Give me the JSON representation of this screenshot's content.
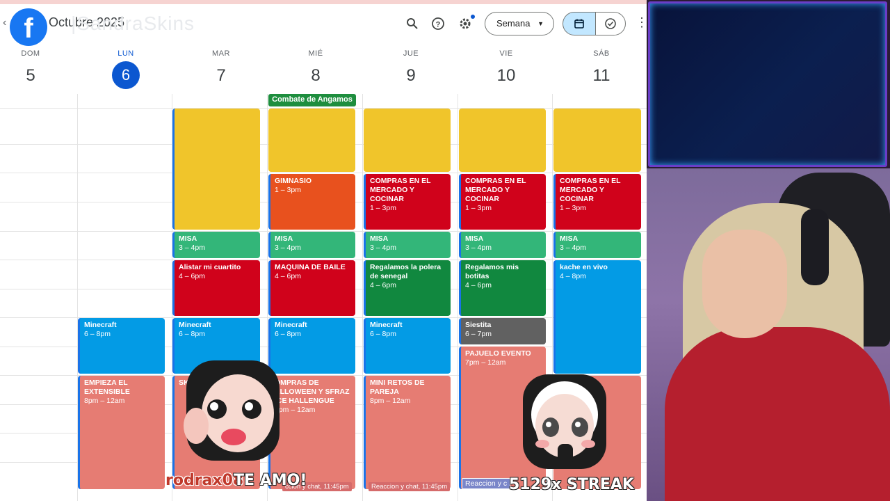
{
  "header": {
    "month": "Octubre 2025",
    "watermark": "|SandraSkins",
    "view_label": "Semana",
    "facebook_glyph": "f"
  },
  "days": [
    {
      "name": "DOM",
      "num": "5"
    },
    {
      "name": "LUN",
      "num": "6"
    },
    {
      "name": "MAR",
      "num": "7"
    },
    {
      "name": "MIÉ",
      "num": "8"
    },
    {
      "name": "JUE",
      "num": "9"
    },
    {
      "name": "VIE",
      "num": "10"
    },
    {
      "name": "SÁB",
      "num": "11"
    }
  ],
  "allday": {
    "title": "Combate de Angamos"
  },
  "events": {
    "gimnasio": {
      "title": "GIMNASIO",
      "time": "1 – 3pm"
    },
    "compras": {
      "title": "COMPRAS EN EL MERCADO Y COCINAR",
      "time": "1 – 3pm"
    },
    "misa": {
      "title": "MISA",
      "time": "3 – 4pm"
    },
    "alistar": {
      "title": "Alistar mi cuartito",
      "time": "4 – 6pm"
    },
    "maquina": {
      "title": "MAQUINA DE BAILE",
      "time": "4 – 6pm"
    },
    "polera": {
      "title": "Regalamos la polera de senegal",
      "time": "4 – 6pm"
    },
    "botitas": {
      "title": "Regalamos mis botitas",
      "time": "4 – 6pm"
    },
    "kache": {
      "title": "kache en vivo",
      "time": "4 – 8pm"
    },
    "minecraft": {
      "title": "Minecraft",
      "time": "6 – 8pm"
    },
    "siestita": {
      "title": "Siestita",
      "time": "6 – 7pm"
    },
    "pajuelo": {
      "title": "PAJUELO EVENTO",
      "time": "7pm – 12am"
    },
    "empieza": {
      "title": "EMPIEZA EL EXTENSIBLE",
      "time": "8pm – 12am"
    },
    "skinca": {
      "title": "SKINCA"
    },
    "halloween": {
      "title": "OMPRAS DE ALLOWEEN Y SFRAZ ICE HALLENGUE",
      "time": "8pm – 12am"
    },
    "retos": {
      "title": "MINI RETOS DE PAREJA",
      "time": "8pm – 12am"
    },
    "reaccion_chat": "Reaccion y chat, 11:45pm",
    "reaccion_chat_cut": "ccion y chat, 11:45pm",
    "reaccion_short": "Reaccion y c"
  },
  "overlays": {
    "username": "rodrax08",
    "message": "TE AMO!",
    "streak": "5129x STREAK"
  },
  "colors": {
    "banana": "#f0c52b",
    "tomato": "#d0021b",
    "tangerine": "#e8511e",
    "basil": "#11883f",
    "sage": "#33b679",
    "peacock": "#039be5",
    "graphite": "#616161",
    "flamingo": "#e67c73",
    "selected_blue": "#0b57d0"
  },
  "icons": [
    "facebook-icon",
    "back-chevron-icon",
    "search-icon",
    "help-icon",
    "settings-icon",
    "dropdown-caret-icon",
    "calendar-icon",
    "tasks-check-icon",
    "apps-grid-icon"
  ]
}
